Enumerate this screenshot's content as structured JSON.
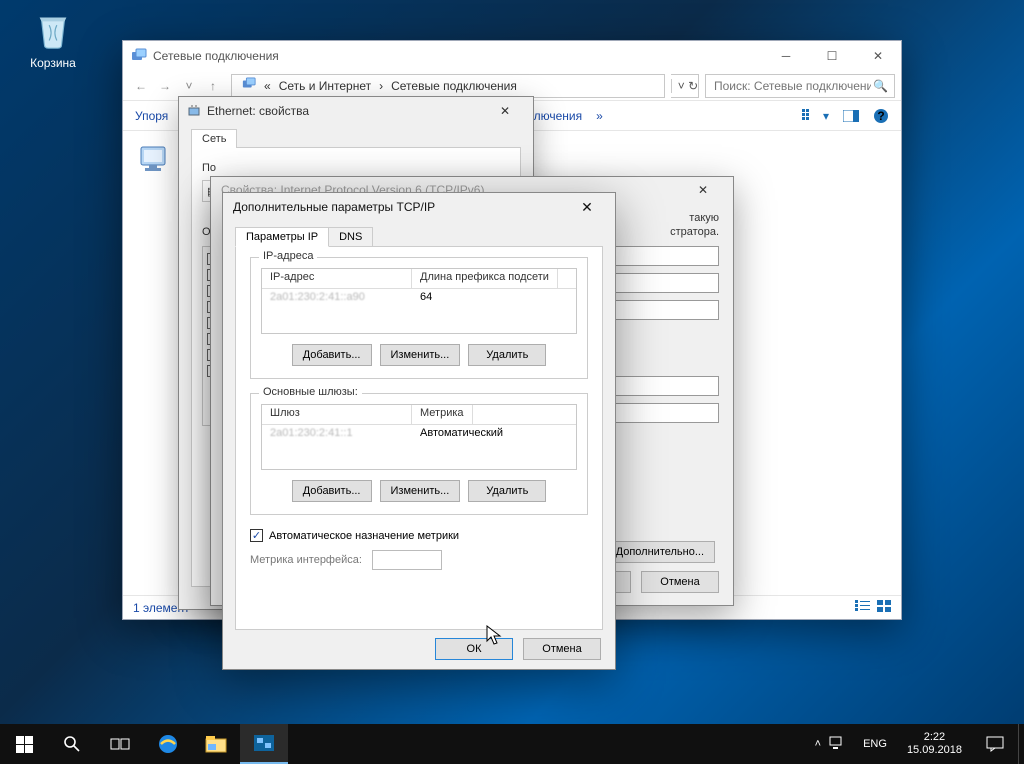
{
  "desktop": {
    "recycle_bin": "Корзина"
  },
  "explorer": {
    "title": "Сетевые подключения",
    "breadcrumb": {
      "prefix": "«",
      "l1": "Сеть и Интернет",
      "l2": "Сетевые подключения"
    },
    "search_placeholder": "Поиск: Сетевые подключения",
    "toolbar": {
      "organize": "Упоря",
      "connection_frag": "а подключения",
      "more": "»"
    },
    "status": "1 элемент"
  },
  "ethernet": {
    "title": "Ethernet: свойства",
    "tab": "Сеть",
    "connect_using": "По",
    "ipv6_title": "Свойства: Internet Protocol Version 6 (TCP/IPv6)",
    "components_label": "От"
  },
  "ipv6": {
    "info_tail": "такую",
    "info_tail2": "стратора.",
    "advanced_btn": "Дополнительно...",
    "ok": "К",
    "cancel": "Отмена"
  },
  "advanced": {
    "title": "Дополнительные параметры TCP/IP",
    "tab_ip": "Параметры IP",
    "tab_dns": "DNS",
    "ip_group": {
      "title": "IP-адреса",
      "col1": "IP-адрес",
      "col2": "Длина префикса подсети",
      "val1": "2a01:230:2:41::a90",
      "val2": "64"
    },
    "gw_group": {
      "title": "Основные шлюзы:",
      "col1": "Шлюз",
      "col2": "Метрика",
      "val1": "2a01:230:2:41::1",
      "val2": "Автоматический"
    },
    "btn_add": "Добавить...",
    "btn_edit": "Изменить...",
    "btn_del": "Удалить",
    "auto_metric": "Автоматическое назначение метрики",
    "metric_label": "Метрика интерфейса:",
    "ok": "ОК",
    "cancel": "Отмена"
  },
  "taskbar": {
    "lang": "ENG",
    "time": "2:22",
    "date": "15.09.2018"
  }
}
